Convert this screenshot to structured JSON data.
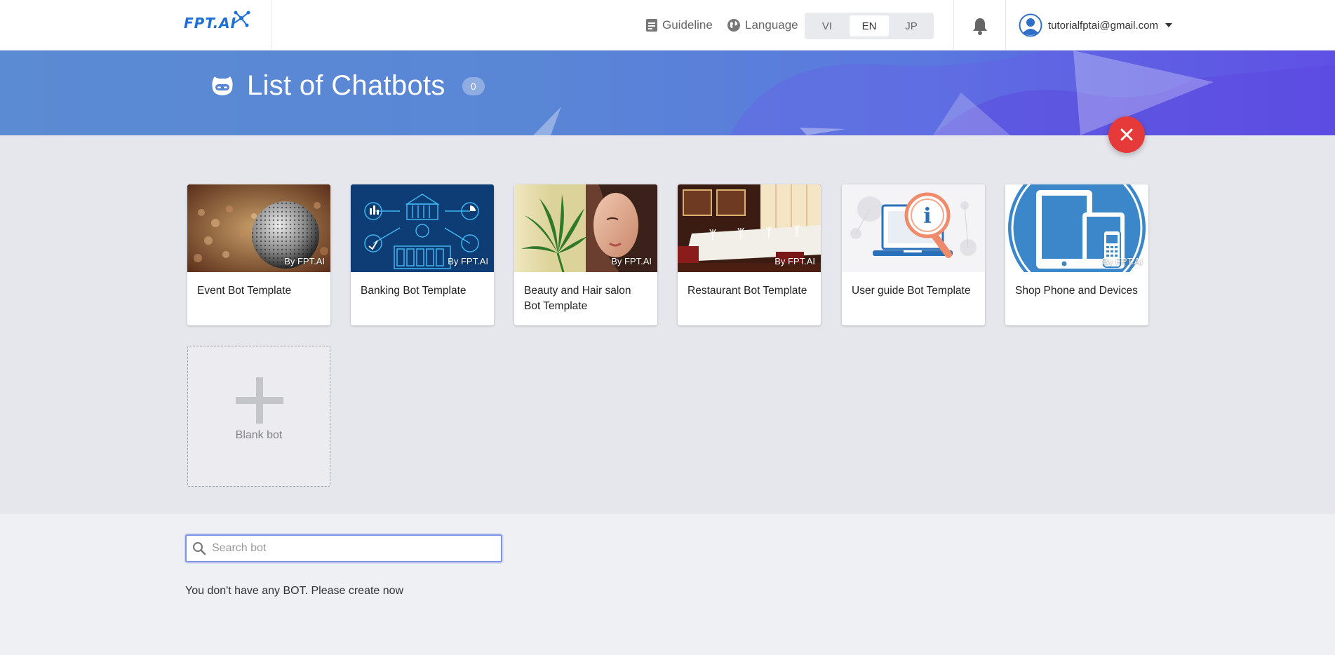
{
  "header": {
    "logo_text": "FPT.AI",
    "guideline_label": "Guideline",
    "language_label": "Language",
    "languages": [
      "VI",
      "EN",
      "JP"
    ],
    "active_language": "EN",
    "user_email": "tutorialfptai@gmail.com"
  },
  "banner": {
    "title": "List of Chatbots",
    "bot_count": "0"
  },
  "templates": [
    {
      "title": "Event Bot Template",
      "byline": "By FPT.AI"
    },
    {
      "title": "Banking Bot Template",
      "byline": "By FPT.AI"
    },
    {
      "title": "Beauty and Hair salon Bot Template",
      "byline": "By FPT.AI"
    },
    {
      "title": "Restaurant Bot Template",
      "byline": "By FPT.AI"
    },
    {
      "title": "User guide Bot Template",
      "byline": "By FPT.AI"
    },
    {
      "title": "Shop Phone and Devices",
      "byline": "By FPT.AI"
    }
  ],
  "blank_bot_label": "Blank bot",
  "search": {
    "placeholder": "Search bot",
    "value": ""
  },
  "empty_message": "You don't have any BOT. Please create now",
  "colors": {
    "banner_start": "#5b8bd3",
    "banner_end": "#5a4be3",
    "close_button": "#e63a3a",
    "search_focus": "#7d93e6",
    "logo_blue": "#1e6fd6"
  }
}
